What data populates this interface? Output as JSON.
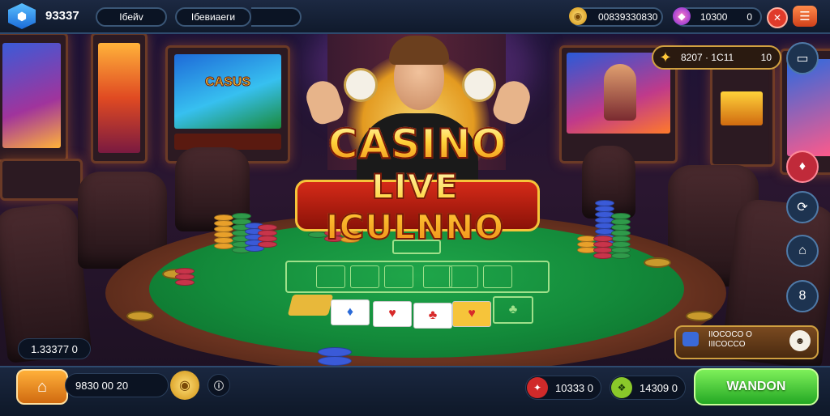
{
  "topbar": {
    "level": "93337",
    "tab1_label": "Iбейv",
    "tab2_label": "Iбевиаеги",
    "gold_amount": "00839330830",
    "gem_amount": "10300",
    "gem_suffix": "0"
  },
  "jackpot": {
    "text": "8207 · 1C11",
    "suffix": "10"
  },
  "logo": {
    "line1": "CASINO",
    "line2": "LIVE ICULNNO"
  },
  "screens": {
    "left": "CASUS",
    "right": ""
  },
  "left_balance": "1.33377 0",
  "bottombar": {
    "chips_value": "9830 00 20",
    "stat_red": "10333 0",
    "stat_green": "14309 0",
    "play_label": "WANDON"
  },
  "promo": {
    "line1": "IIOCOCO O",
    "line2": "IIICOCCO"
  },
  "icons": {
    "level": "hexagon-icon",
    "gold": "coin-icon",
    "gem": "gem-icon",
    "close": "close-icon",
    "menu": "menu-icon",
    "cast": "screen-icon",
    "location": "pin-icon",
    "refresh": "refresh-icon",
    "shop": "shop-icon",
    "ranking": "medal-icon",
    "home": "home-icon",
    "wallet": "wallet-icon"
  },
  "colors": {
    "accent_green": "#24a824",
    "gold": "#ffd23a",
    "panel": "#1c2942"
  }
}
